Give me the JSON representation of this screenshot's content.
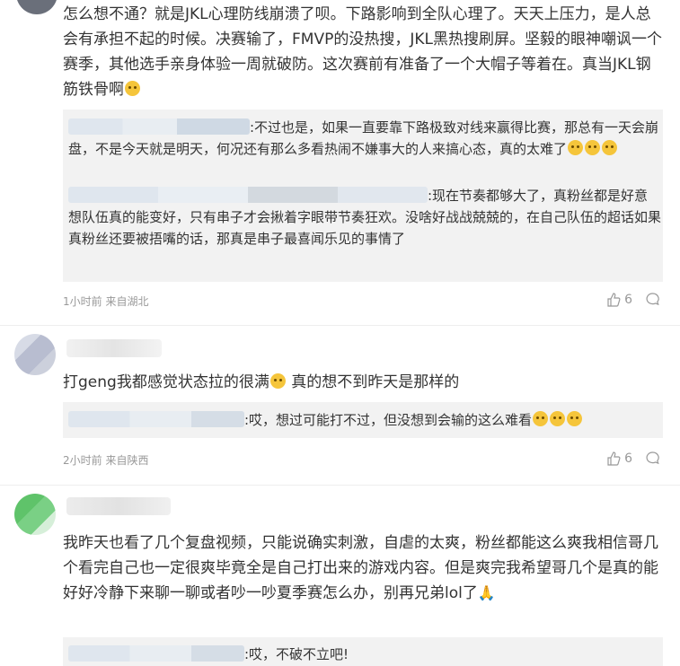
{
  "comments": [
    {
      "text": "怎么想不通？就是JKL心理防线崩溃了呗。下路影响到全队心理了。天天上压力，是人总会有承担不起的时候。决赛输了，FMVP的没热搜，JKL黑热搜刷屏。坚毅的眼神嘲讽一个赛季，其他选手亲身体验一周就破防。这次赛前有准备了一个大帽子等着在。真当JKL钢筋铁骨啊",
      "replies": [
        {
          "text": ":不过也是，如果一直要靠下路极致对线来赢得比赛，那总有一天会崩盘，不是今天就是明天，何况还有那么多看热闹不嫌事大的人来搞心态，真的太难了"
        },
        {
          "text": ":现在节奏都够大了，真粉丝都是好意想队伍真的能变好，只有串子才会揪着字眼带节奏狂欢。没啥好战战兢兢的，在自己队伍的超话如果真粉丝还要被捂嘴的话，那真是串子最喜闻乐见的事情了"
        }
      ],
      "time": "1小时前 来自湖北",
      "likes": "6"
    },
    {
      "text": "打geng我都感觉状态拉的很满",
      "text2": " 真的想不到昨天是那样的",
      "replies": [
        {
          "text": ":哎，想过可能打不过，但没想到会输的这么难看"
        }
      ],
      "time": "2小时前 来自陕西",
      "likes": "6"
    },
    {
      "text": "我昨天也看了几个复盘视频，只能说确实刺激，自虐的太爽，粉丝都能这么爽我相信哥几个看完自己也一定很爽毕竟全是自己打出来的游戏内容。但是爽完我希望哥几个是真的能好好冷静下来聊一聊或者吵一吵夏季赛怎么办，别再兄弟lol了",
      "replies": [
        {
          "text": ":哎，不破不立吧!"
        }
      ]
    }
  ],
  "icons": {
    "like": "thumb-up-icon",
    "comment": "comment-bubble-icon",
    "emoji_cry": "crying-face-emoji",
    "emoji_pray": "folded-hands-emoji"
  },
  "colors": {
    "text": "#333333",
    "meta": "#999999",
    "reply_bg": "#f2f2f2"
  }
}
